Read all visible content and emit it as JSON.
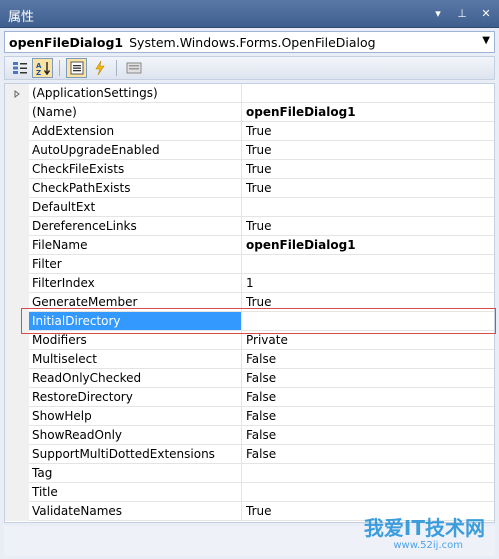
{
  "window": {
    "title": "属性",
    "buttons": [
      "▾",
      "⊥",
      "✕"
    ]
  },
  "object_selector": {
    "name": "openFileDialog1",
    "type": "System.Windows.Forms.OpenFileDialog"
  },
  "toolbar": {
    "items": [
      "categorized-icon",
      "alphabetical-icon",
      "properties-icon",
      "events-icon",
      "property-pages-icon"
    ]
  },
  "properties": [
    {
      "name": "(ApplicationSettings)",
      "value": "",
      "expandable": true
    },
    {
      "name": "(Name)",
      "value": "openFileDialog1",
      "bold": true
    },
    {
      "name": "AddExtension",
      "value": "True"
    },
    {
      "name": "AutoUpgradeEnabled",
      "value": "True"
    },
    {
      "name": "CheckFileExists",
      "value": "True"
    },
    {
      "name": "CheckPathExists",
      "value": "True"
    },
    {
      "name": "DefaultExt",
      "value": ""
    },
    {
      "name": "DereferenceLinks",
      "value": "True"
    },
    {
      "name": "FileName",
      "value": "openFileDialog1",
      "bold": true
    },
    {
      "name": "Filter",
      "value": ""
    },
    {
      "name": "FilterIndex",
      "value": "1"
    },
    {
      "name": "GenerateMember",
      "value": "True"
    },
    {
      "name": "InitialDirectory",
      "value": "",
      "selected": true
    },
    {
      "name": "Modifiers",
      "value": "Private"
    },
    {
      "name": "Multiselect",
      "value": "False"
    },
    {
      "name": "ReadOnlyChecked",
      "value": "False"
    },
    {
      "name": "RestoreDirectory",
      "value": "False"
    },
    {
      "name": "ShowHelp",
      "value": "False"
    },
    {
      "name": "ShowReadOnly",
      "value": "False"
    },
    {
      "name": "SupportMultiDottedExtensions",
      "value": "False"
    },
    {
      "name": "Tag",
      "value": ""
    },
    {
      "name": "Title",
      "value": ""
    },
    {
      "name": "ValidateNames",
      "value": "True"
    }
  ],
  "watermark": {
    "text": "我爱IT技术网",
    "url": "www.52ij.com"
  },
  "colors": {
    "selection": "#3399ff",
    "highlight_border": "#d94a4a",
    "titlebar": "#4a6a9a"
  }
}
